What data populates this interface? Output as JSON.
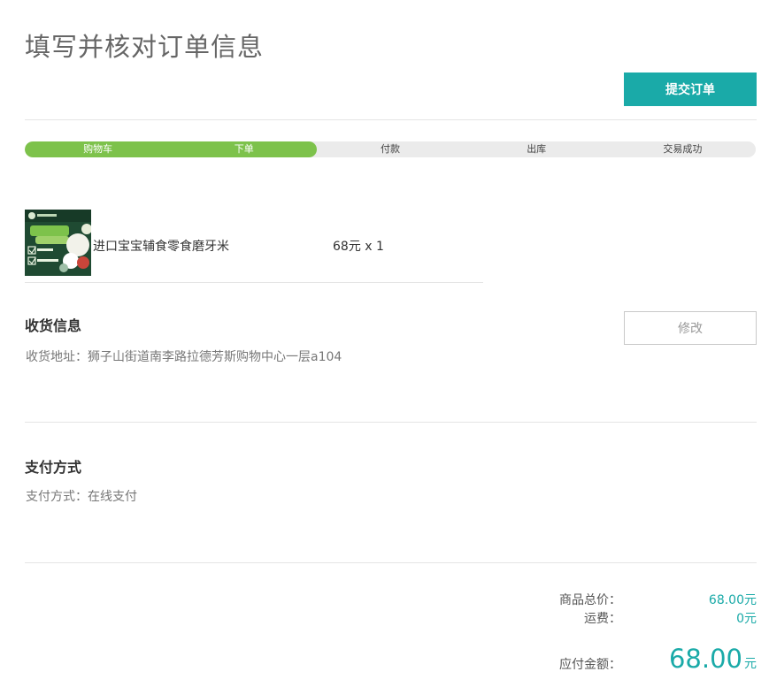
{
  "page_title": "填写并核对订单信息",
  "submit_label": "提交订单",
  "progress": {
    "completed_steps": 2,
    "total_steps": 5,
    "steps": [
      "购物车",
      "下单",
      "付款",
      "出库",
      "交易成功"
    ]
  },
  "product": {
    "name": "进口宝宝辅食零食磨牙米",
    "price_qty": "68元 x 1",
    "thumb_colors": {
      "bg": "#1f4a32",
      "accent": "#7dc24b"
    }
  },
  "shipping": {
    "title": "收货信息",
    "address_label": "收货地址：",
    "address": "狮子山街道南李路拉德芳斯购物中心一层a104",
    "edit_label": "修改"
  },
  "payment": {
    "title": "支付方式",
    "method_label": "支付方式：",
    "method": "在线支付"
  },
  "summary": {
    "goods_total_label": "商品总价：",
    "goods_total": "68.00元",
    "shipping_label": "运费：",
    "shipping_fee": "0元",
    "payable_label": "应付金额：",
    "payable_amount": "68.00",
    "payable_unit": "元"
  },
  "colors": {
    "accent": "#1aaaa8",
    "progress_done": "#7dc24b",
    "progress_todo": "#ebebeb"
  }
}
